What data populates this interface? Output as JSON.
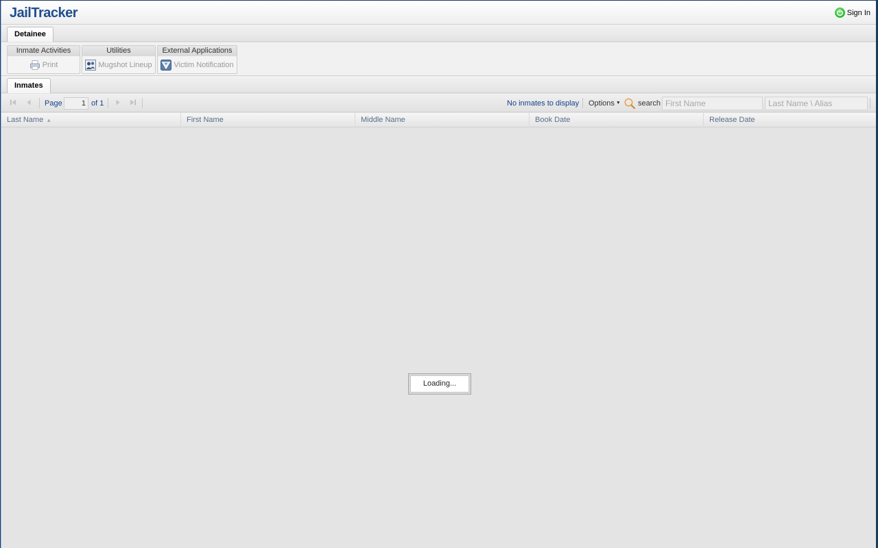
{
  "header": {
    "logo": "JailTracker",
    "signin_label": "Sign In"
  },
  "top_tab": {
    "label": "Detainee"
  },
  "ribbon": {
    "groups": [
      {
        "title": "Inmate Activities",
        "button": "Print",
        "icon": "printer-icon"
      },
      {
        "title": "Utilities",
        "button": "Mugshot Lineup",
        "icon": "mugshot-icon"
      },
      {
        "title": "External Applications",
        "button": "Victim Notification",
        "icon": "vine-icon"
      }
    ]
  },
  "inner_tab": {
    "label": "Inmates"
  },
  "paging": {
    "page_label": "Page",
    "page_value": "1",
    "of_label": "of 1",
    "status": "No inmates to display",
    "options_label": "Options",
    "search_label": "search",
    "first_name_placeholder": "First Name",
    "last_name_placeholder": "Last Name \\ Alias"
  },
  "grid": {
    "columns": [
      "Last Name",
      "First Name",
      "Middle Name",
      "Book Date",
      "Release Date"
    ],
    "sorted_column": "Last Name",
    "sort_direction": "ascending"
  },
  "loading_text": "Loading...",
  "colors": {
    "brand": "#1f4e8c",
    "signin_power": "#1aa31a",
    "column_text": "#5a6e8a"
  }
}
